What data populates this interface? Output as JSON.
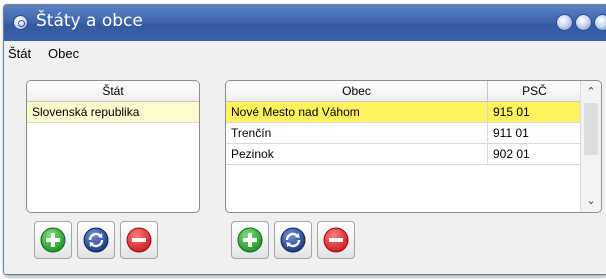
{
  "window": {
    "title": "Štáty a obce"
  },
  "menu": [
    "Štát",
    "Obec"
  ],
  "states_table": {
    "columns": [
      "Štát"
    ],
    "rows": [
      {
        "state": "Slovenská republika",
        "selected": true
      }
    ]
  },
  "municipalities_table": {
    "columns": [
      "Obec",
      "PSČ"
    ],
    "rows": [
      {
        "name": "Nové Mesto nad Váhom",
        "psc": "915 01",
        "selected": true
      },
      {
        "name": "Trenčín",
        "psc": "911 01",
        "selected": false
      },
      {
        "name": "Pezinok",
        "psc": "902 01",
        "selected": false
      }
    ]
  },
  "scrollbar": {
    "up_arrow": "⌃",
    "down_arrow": "⌄"
  },
  "icons": {
    "add": "plus-icon",
    "refresh": "refresh-icon",
    "delete": "minus-icon"
  },
  "colors": {
    "titlebar": "#3f66ae",
    "selected_row_strong": "#fff25e",
    "selected_row_light": "#fdfacd",
    "add_green": "#21a325",
    "refresh_blue": "#1c3f8f",
    "delete_red": "#e01c24"
  }
}
